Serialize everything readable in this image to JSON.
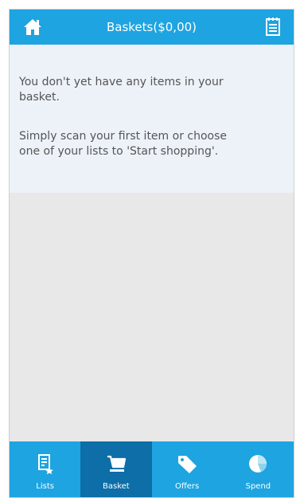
{
  "header": {
    "title": "Baskets($0,00)",
    "home_icon": "home-icon",
    "list_icon": "notepad-icon"
  },
  "message": {
    "line1": "You don't yet have any items in your basket.",
    "line2": "Simply scan your first item or choose one of your lists to 'Start shopping'."
  },
  "tabs": [
    {
      "label": "Lists",
      "icon": "list-star-icon",
      "active": false
    },
    {
      "label": "Basket",
      "icon": "cart-icon",
      "active": true
    },
    {
      "label": "Offers",
      "icon": "tag-icon",
      "active": false
    },
    {
      "label": "Spend",
      "icon": "pie-chart-icon",
      "active": false
    }
  ],
  "colors": {
    "accent": "#1ea4e0",
    "active_tab": "#0d6ea8"
  }
}
